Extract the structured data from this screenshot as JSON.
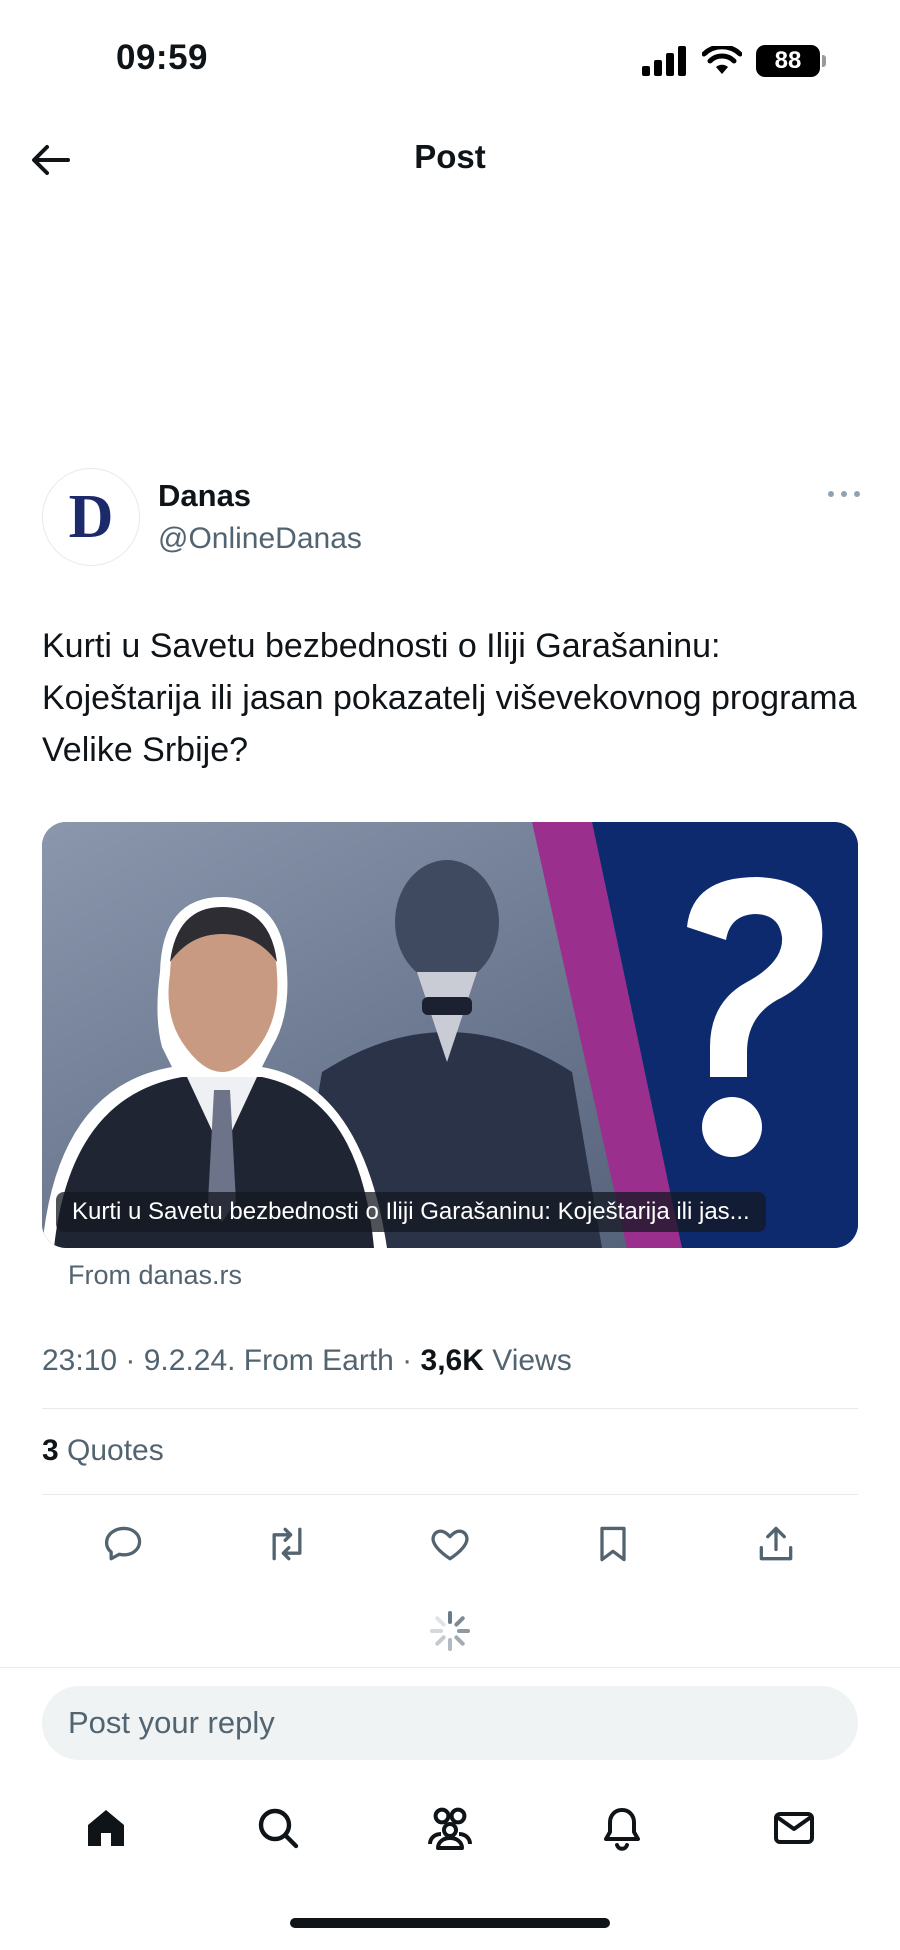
{
  "status": {
    "time": "09:59",
    "battery": "88"
  },
  "nav": {
    "title": "Post"
  },
  "author": {
    "name": "Danas",
    "handle": "@OnlineDanas",
    "avatar_letter": "D"
  },
  "post": {
    "text": "Kurti u Savetu bezbednosti o Iliji Garašaninu: Koještarija ili jasan pokazatelj viševekovnog programa Velike Srbije?",
    "card_caption": "Kurti u Savetu bezbednosti o Iliji Garašaninu: Koještarija ili jas...",
    "card_source": "From danas.rs",
    "meta_prefix": "23:10 · 9.2.24. From Earth · ",
    "views_count": "3,6K",
    "views_label": " Views",
    "quotes_count": "3",
    "quotes_label": " Quotes"
  },
  "reply": {
    "placeholder": "Post your reply"
  },
  "colors": {
    "text": "#0f1419",
    "secondary": "#536471",
    "brand_navy": "#1c2a6b",
    "card_blue": "#0e2a6e",
    "card_magenta": "#9b2f8e"
  },
  "icons": {
    "actions": [
      "reply-icon",
      "repost-icon",
      "like-icon",
      "bookmark-icon",
      "share-icon"
    ],
    "tabs": [
      "home-icon",
      "search-icon",
      "communities-icon",
      "notifications-icon",
      "messages-icon"
    ]
  }
}
